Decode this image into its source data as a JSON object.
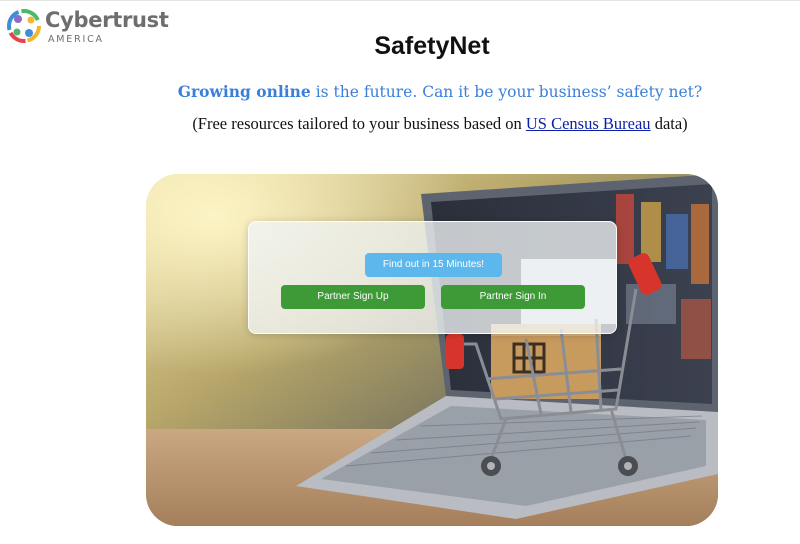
{
  "logo": {
    "name": "Cybertrust",
    "subtitle": "AMERICA"
  },
  "header": {
    "title": "SafetyNet"
  },
  "tagline": {
    "emphasis": "Growing online",
    "rest": " is the future. Can it be your business’ safety net?"
  },
  "subline": {
    "prefix": "(Free resources tailored to your business based on ",
    "link_text": "US Census Bureau",
    "suffix": " data)"
  },
  "hero": {
    "buttons": {
      "cta_label": "Find out in 15 Minutes!",
      "signup_label": "Partner Sign Up",
      "signin_label": "Partner Sign In"
    }
  },
  "colors": {
    "tagline": "#3b7fd9",
    "link": "#0b1fa8",
    "cta_button": "#5cb8ec",
    "partner_buttons": "#3d9a36"
  }
}
